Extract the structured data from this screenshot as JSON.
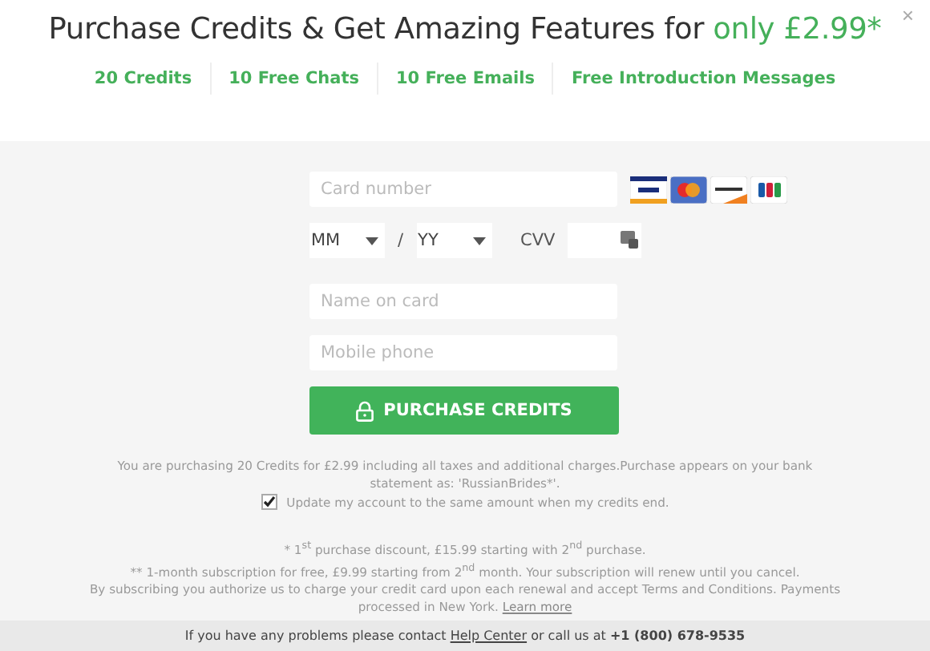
{
  "close": "×",
  "title": {
    "text": "Purchase Credits & Get Amazing Features for",
    "highlight": "only £2.99*"
  },
  "features": [
    "20 Credits",
    "10 Free Chats",
    "10 Free Emails",
    "Free Introduction Messages"
  ],
  "form": {
    "card_number": {
      "placeholder": "Card number"
    },
    "expiry": {
      "month": "MM",
      "separator": "/",
      "year": "YY"
    },
    "cvv": {
      "label": "CVV"
    },
    "name": {
      "placeholder": "Name on card"
    },
    "phone": {
      "placeholder": "Mobile phone"
    },
    "submit": "PURCHASE CREDITS"
  },
  "notice": "You are purchasing 20 Credits for £2.99  including all taxes and additional charges.Purchase appears on your bank statement as: 'RussianBrides*'.",
  "auto_renew": {
    "label": "Update my account to the same amount when my credits end.",
    "checked": true
  },
  "footnotes": [
    "* 1$^{st}$ purchase discount, £15.99 starting with 2$^{nd}$ purchase.",
    "** 1-month subscription for free, £9.99 starting from 2$^{nd}$ month. Your subscription will renew until you cancel."
  ],
  "terms": {
    "text": "By subscribing you authorize us to charge your credit card upon each renewal and accept Terms and Conditions. Payments processed in New York.",
    "link": "Learn more"
  },
  "footer": {
    "text": "If you have any problems please contact",
    "link": "Help Center",
    "text_2": "or call us at",
    "phone": "+1 (800) 678-9535"
  }
}
